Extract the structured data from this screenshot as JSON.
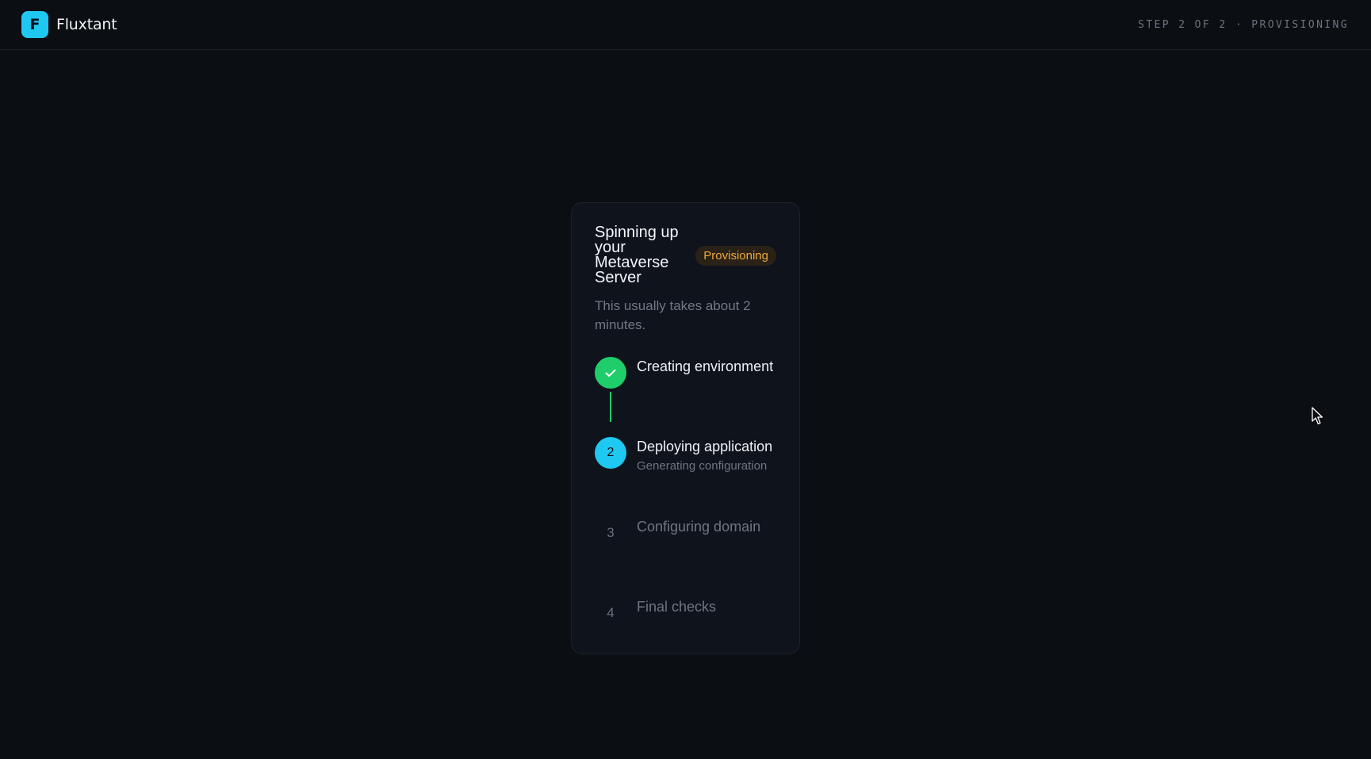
{
  "header": {
    "logo_letter": "F",
    "brand_name": "Fluxtant",
    "step_indicator": "STEP 2 OF 2 · PROVISIONING"
  },
  "card": {
    "title": "Spinning up your Metaverse Server",
    "status_badge": "Provisioning",
    "subtitle": "This usually takes about 2 minutes.",
    "steps": [
      {
        "marker": "✓",
        "label": "Creating environment",
        "detail": "",
        "state": "done"
      },
      {
        "marker": "2",
        "label": "Deploying application",
        "detail": "Generating configuration",
        "state": "active"
      },
      {
        "marker": "3",
        "label": "Configuring domain",
        "detail": "",
        "state": "pending"
      },
      {
        "marker": "4",
        "label": "Final checks",
        "detail": "",
        "state": "pending"
      }
    ]
  },
  "colors": {
    "accent": "#1ec8f0",
    "success": "#1fce6a",
    "warning": "#f0a93c",
    "background": "#0b0e12"
  },
  "icons": {
    "check": "check-icon",
    "cursor": "mouse-pointer-icon"
  }
}
